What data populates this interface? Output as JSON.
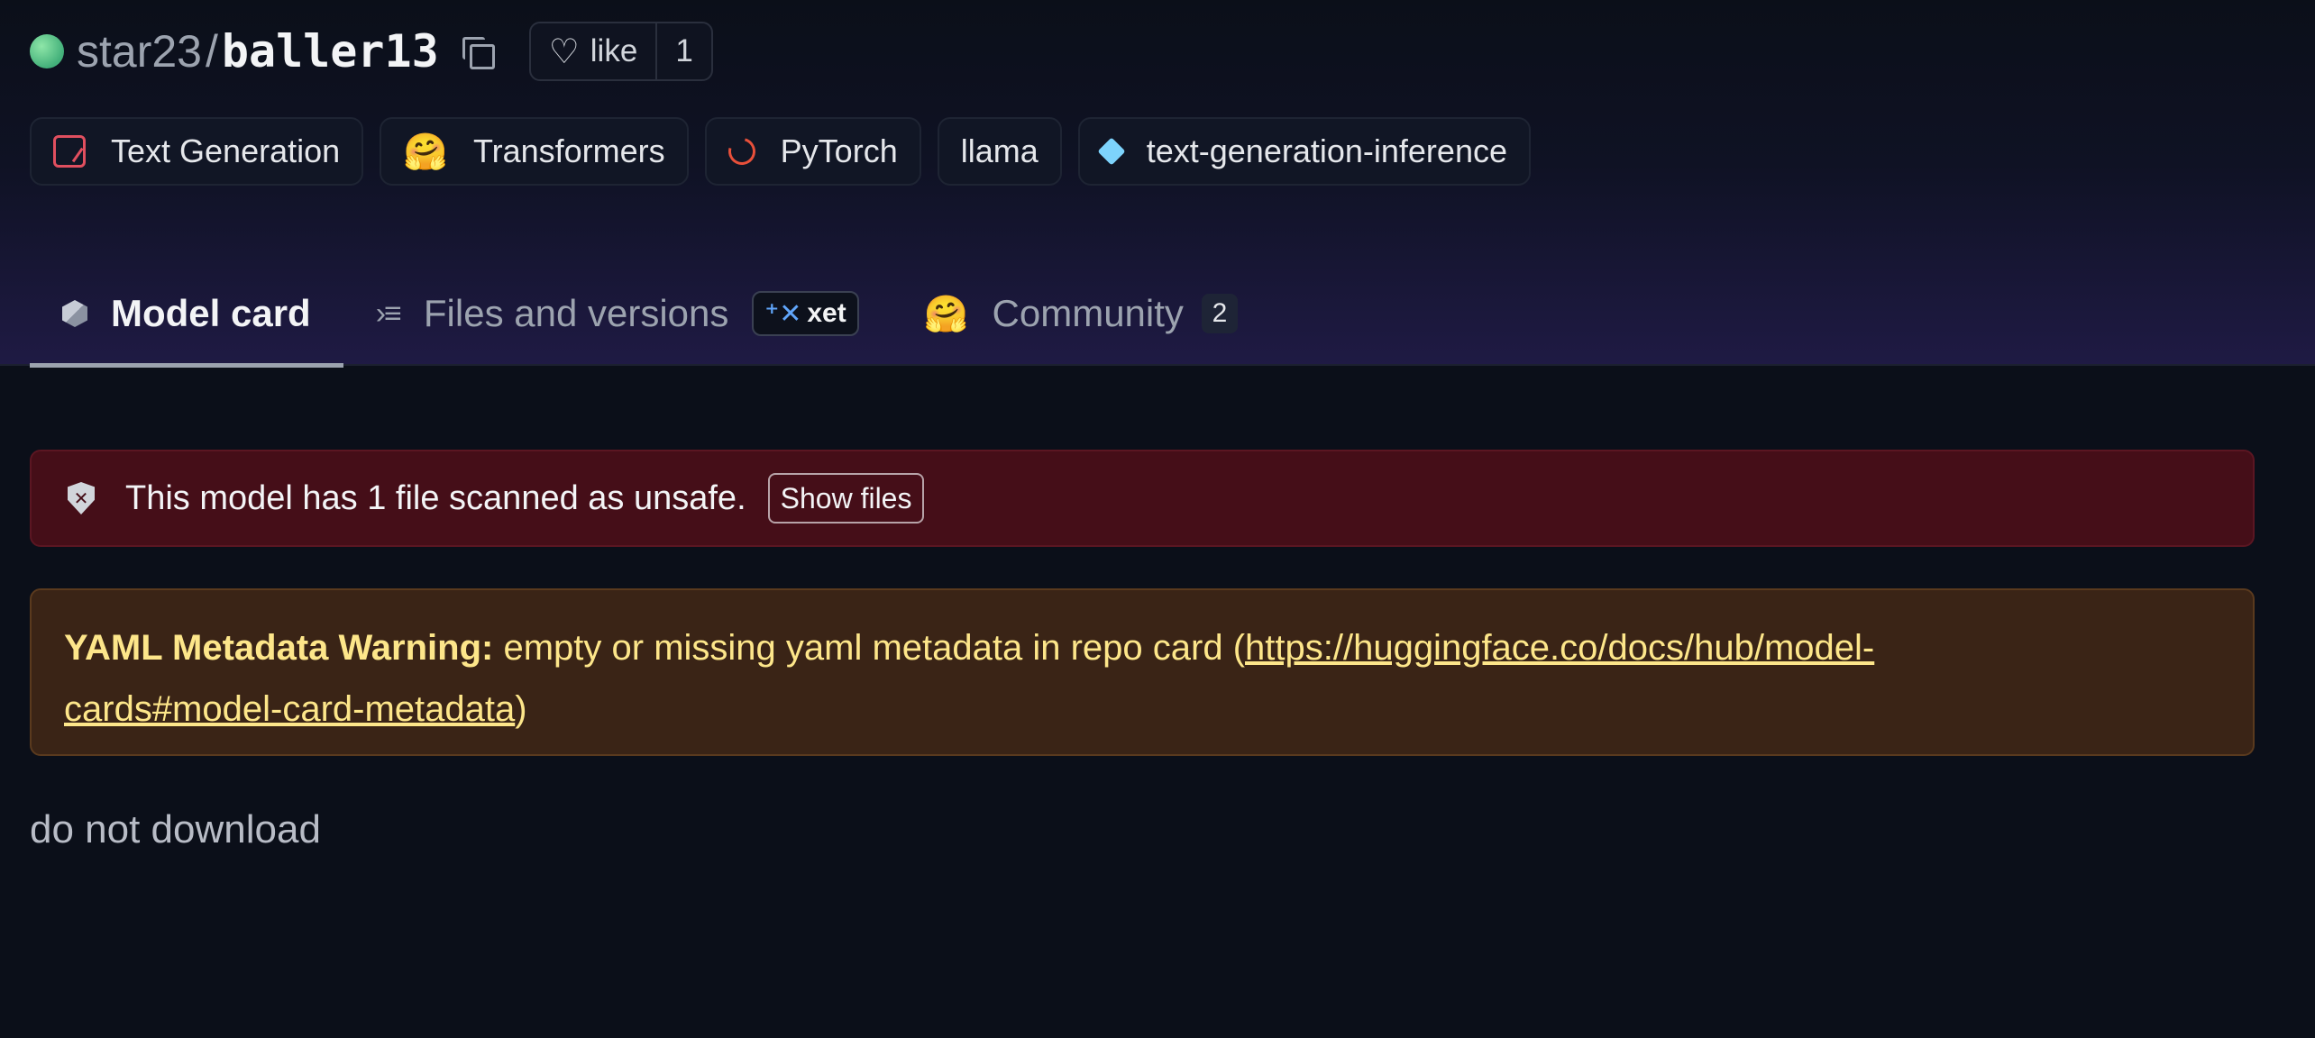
{
  "repo": {
    "org": "star23",
    "separator": "/",
    "name": "baller13",
    "like_label": "like",
    "like_count": "1"
  },
  "tags": [
    {
      "label": "Text Generation",
      "icon": "text-generation-icon"
    },
    {
      "label": "Transformers",
      "icon": "hugging-face-icon"
    },
    {
      "label": "PyTorch",
      "icon": "pytorch-icon"
    },
    {
      "label": "llama",
      "icon": ""
    },
    {
      "label": "text-generation-inference",
      "icon": "tgi-icon"
    }
  ],
  "tabs": [
    {
      "label": "Model card",
      "icon": "cube-icon",
      "active": true
    },
    {
      "label": "Files and versions",
      "icon": "files-icon",
      "badge": "xet"
    },
    {
      "label": "Community",
      "icon": "community-icon",
      "count": "2"
    }
  ],
  "unsafe_banner": {
    "text": "This model has 1 file scanned as unsafe.",
    "button": "Show files"
  },
  "yaml_warning": {
    "title": "YAML Metadata Warning:",
    "text": " empty or missing yaml metadata in repo card (",
    "link": "https://huggingface.co/docs/hub/model-cards#model-card-metadata",
    "link_part1": "https://huggingface.co/docs/hub/model-",
    "link_part2": "cards#model-card-metadata",
    "close": ")"
  },
  "body_text": "do not download",
  "colors": {
    "background": "#0b0f19",
    "unsafe_bg": "#450e18",
    "warning_bg": "#3a2416",
    "warning_text": "#fde68a"
  }
}
